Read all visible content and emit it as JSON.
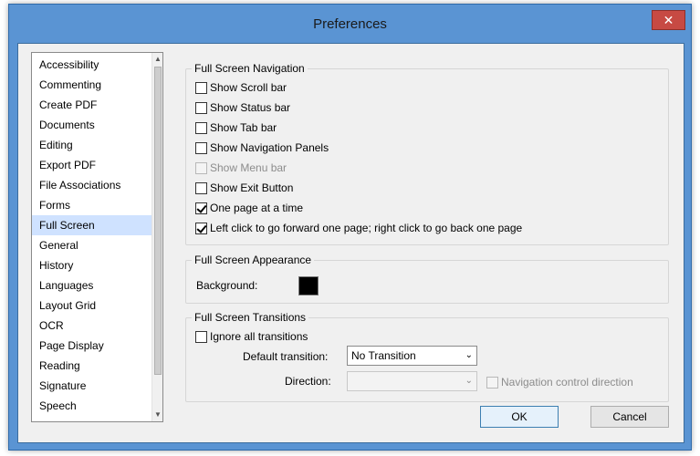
{
  "window": {
    "title": "Preferences",
    "close_icon": "close-icon",
    "colors": {
      "frame": "#5a94d3",
      "client": "#f0f0f0",
      "selection": "#cfe2ff"
    }
  },
  "sidebar": {
    "items": [
      {
        "label": "Accessibility"
      },
      {
        "label": "Commenting"
      },
      {
        "label": "Create PDF"
      },
      {
        "label": "Documents"
      },
      {
        "label": "Editing"
      },
      {
        "label": "Export PDF"
      },
      {
        "label": "File Associations"
      },
      {
        "label": "Forms"
      },
      {
        "label": "Full Screen",
        "selected": true
      },
      {
        "label": "General"
      },
      {
        "label": "History"
      },
      {
        "label": "Languages"
      },
      {
        "label": "Layout Grid"
      },
      {
        "label": "OCR"
      },
      {
        "label": "Page Display"
      },
      {
        "label": "Reading"
      },
      {
        "label": "Signature"
      },
      {
        "label": "Speech"
      }
    ]
  },
  "navigation": {
    "legend": "Full Screen Navigation",
    "options": [
      {
        "label": "Show Scroll bar",
        "checked": false,
        "disabled": false
      },
      {
        "label": "Show Status bar",
        "checked": false,
        "disabled": false
      },
      {
        "label": "Show Tab bar",
        "checked": false,
        "disabled": false
      },
      {
        "label": "Show Navigation Panels",
        "checked": false,
        "disabled": false
      },
      {
        "label": "Show Menu bar",
        "checked": false,
        "disabled": true
      },
      {
        "label": "Show Exit Button",
        "checked": false,
        "disabled": false
      },
      {
        "label": "One page at a time",
        "checked": true,
        "disabled": false
      },
      {
        "label": "Left click to go forward one page; right click to go back one page",
        "checked": true,
        "disabled": false
      }
    ]
  },
  "appearance": {
    "legend": "Full Screen Appearance",
    "background_label": "Background:",
    "background_color": "#000000"
  },
  "transitions": {
    "legend": "Full Screen Transitions",
    "ignore_label": "Ignore all transitions",
    "ignore_checked": false,
    "default_label": "Default transition:",
    "default_value": "No Transition",
    "direction_label": "Direction:",
    "direction_value": "",
    "nav_control_label": "Navigation control direction",
    "nav_control_checked": false
  },
  "buttons": {
    "ok": "OK",
    "cancel": "Cancel"
  }
}
